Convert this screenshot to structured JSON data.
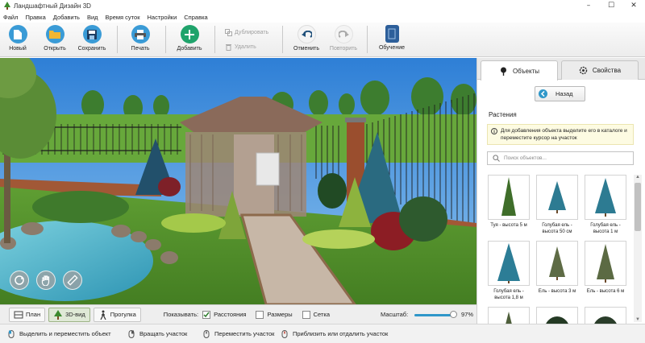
{
  "window": {
    "title": "Ландшафтный Дизайн 3D",
    "minimize": "–",
    "maximize": "☐",
    "close": "✕"
  },
  "menu": [
    "Файл",
    "Правка",
    "Добавить",
    "Вид",
    "Время суток",
    "Настройки",
    "Справка"
  ],
  "toolbar": {
    "new": "Новый",
    "open": "Открыть",
    "save": "Сохранить",
    "print": "Печать",
    "add": "Добавить",
    "duplicate": "Дублировать",
    "delete": "Удалить",
    "undo": "Отменить",
    "redo": "Повторить",
    "learn": "Обучение"
  },
  "bottom": {
    "modes": [
      "План",
      "3D-вид",
      "Прогулка"
    ],
    "show_label": "Показывать:",
    "checks": [
      {
        "label": "Расстояния",
        "checked": true
      },
      {
        "label": "Размеры",
        "checked": false
      },
      {
        "label": "Сетка",
        "checked": false
      }
    ],
    "zoom_label": "Масштаб:",
    "zoom_value": "97%",
    "zoom_fraction": 0.97
  },
  "status": {
    "hints": [
      "Выделить и переместить объект",
      "Вращать участок",
      "Переместить участок",
      "Приблизить или отдалить участок"
    ]
  },
  "panel": {
    "tab_objects": "Объекты",
    "tab_properties": "Свойства",
    "back": "Назад",
    "section": "Растения",
    "info": "Для добавления объекта выделите его в каталоге и переместите курсор на участок",
    "search_placeholder": "Поиск объектов...",
    "items": [
      {
        "label": "Туя - высота 5 м"
      },
      {
        "label": "Голубая ель - высота 50 см"
      },
      {
        "label": "Голубая ель - высота 1 м"
      },
      {
        "label": "Голубая ель - высота 1,8 м"
      },
      {
        "label": "Ель - высота 3 м"
      },
      {
        "label": "Ель - высота 6 м"
      },
      {
        "label": ""
      },
      {
        "label": ""
      },
      {
        "label": ""
      }
    ]
  },
  "colors": {
    "accent_blue": "#2f97c9",
    "add_green": "#1fa36b",
    "learn_blue": "#2d5f9a"
  }
}
